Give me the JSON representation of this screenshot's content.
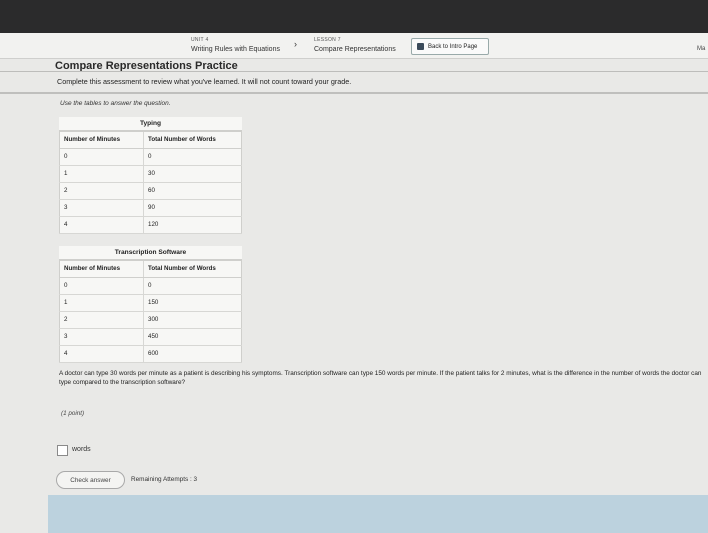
{
  "header": {
    "unit_label": "UNIT 4",
    "unit_title": "Writing Rules with Equations",
    "lesson_label": "LESSON 7",
    "lesson_title": "Compare Representations",
    "back_button": "Back to Intro Page",
    "edge_text": "Ma"
  },
  "page": {
    "title": "Compare Representations Practice",
    "description": "Complete this assessment to review what you've learned. It will not count toward your grade.",
    "instruction": "Use the tables to answer the question."
  },
  "tables": {
    "typing": {
      "title": "Typing",
      "headers": [
        "Number of Minutes",
        "Total Number of Words"
      ],
      "rows": [
        [
          "0",
          "0"
        ],
        [
          "1",
          "30"
        ],
        [
          "2",
          "60"
        ],
        [
          "3",
          "90"
        ],
        [
          "4",
          "120"
        ]
      ]
    },
    "software": {
      "title": "Transcription Software",
      "headers": [
        "Number of Minutes",
        "Total Number of Words"
      ],
      "rows": [
        [
          "0",
          "0"
        ],
        [
          "1",
          "150"
        ],
        [
          "2",
          "300"
        ],
        [
          "3",
          "450"
        ],
        [
          "4",
          "600"
        ]
      ]
    }
  },
  "question": {
    "text": "A doctor can type 30 words per minute as a patient is describing his symptoms. Transcription software can type 150 words per minute. If the patient talks for 2 minutes, what is the difference in the number of words the doctor can type compared to the transcription software?",
    "points": "(1 point)",
    "answer_value": "",
    "answer_unit": "words",
    "check_button": "Check answer",
    "remaining": "Remaining Attempts : 3"
  },
  "colors": {
    "top_bar": "#2b2b2c",
    "footer": "#bcd2de"
  }
}
